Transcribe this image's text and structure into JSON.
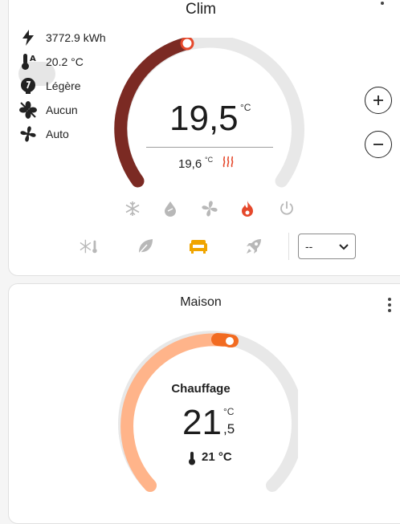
{
  "clim": {
    "title": "Clim",
    "attributes": [
      {
        "icon": "flash-icon",
        "text": "3772.9 kWh"
      },
      {
        "icon": "thermometer-auto-icon",
        "text": "20.2 °C"
      },
      {
        "icon": "speed-badge-icon",
        "text": "Légère"
      },
      {
        "icon": "fan-off-icon",
        "text": "Aucun"
      },
      {
        "icon": "fan-icon",
        "text": "Auto"
      }
    ],
    "target_temp": "19,5",
    "target_unit": "°C",
    "current_temp": "19,6",
    "current_unit": "°C",
    "modes": [
      "snowflake-icon",
      "water-drop-icon",
      "fan-icon",
      "fire-icon",
      "power-icon"
    ],
    "presets": [
      "thermometer-snowflake-icon",
      "leaf-icon",
      "sofa-icon",
      "rocket-icon"
    ],
    "select_value": "--",
    "colors": {
      "arc_active": "#7b2a23",
      "arc_track": "#e8e8e8",
      "heat": "#e5482b",
      "preset_active": "#f0a500",
      "muted": "#b8b8b8"
    }
  },
  "maison": {
    "title": "Maison",
    "action": "Chauffage",
    "target_int": "21",
    "target_dec": ",5",
    "target_unit": "°C",
    "current_temp": "21 °C",
    "colors": {
      "arc_active": "#ffb48a",
      "arc_track": "#e8e8e8",
      "handle": "#f26b21"
    }
  }
}
